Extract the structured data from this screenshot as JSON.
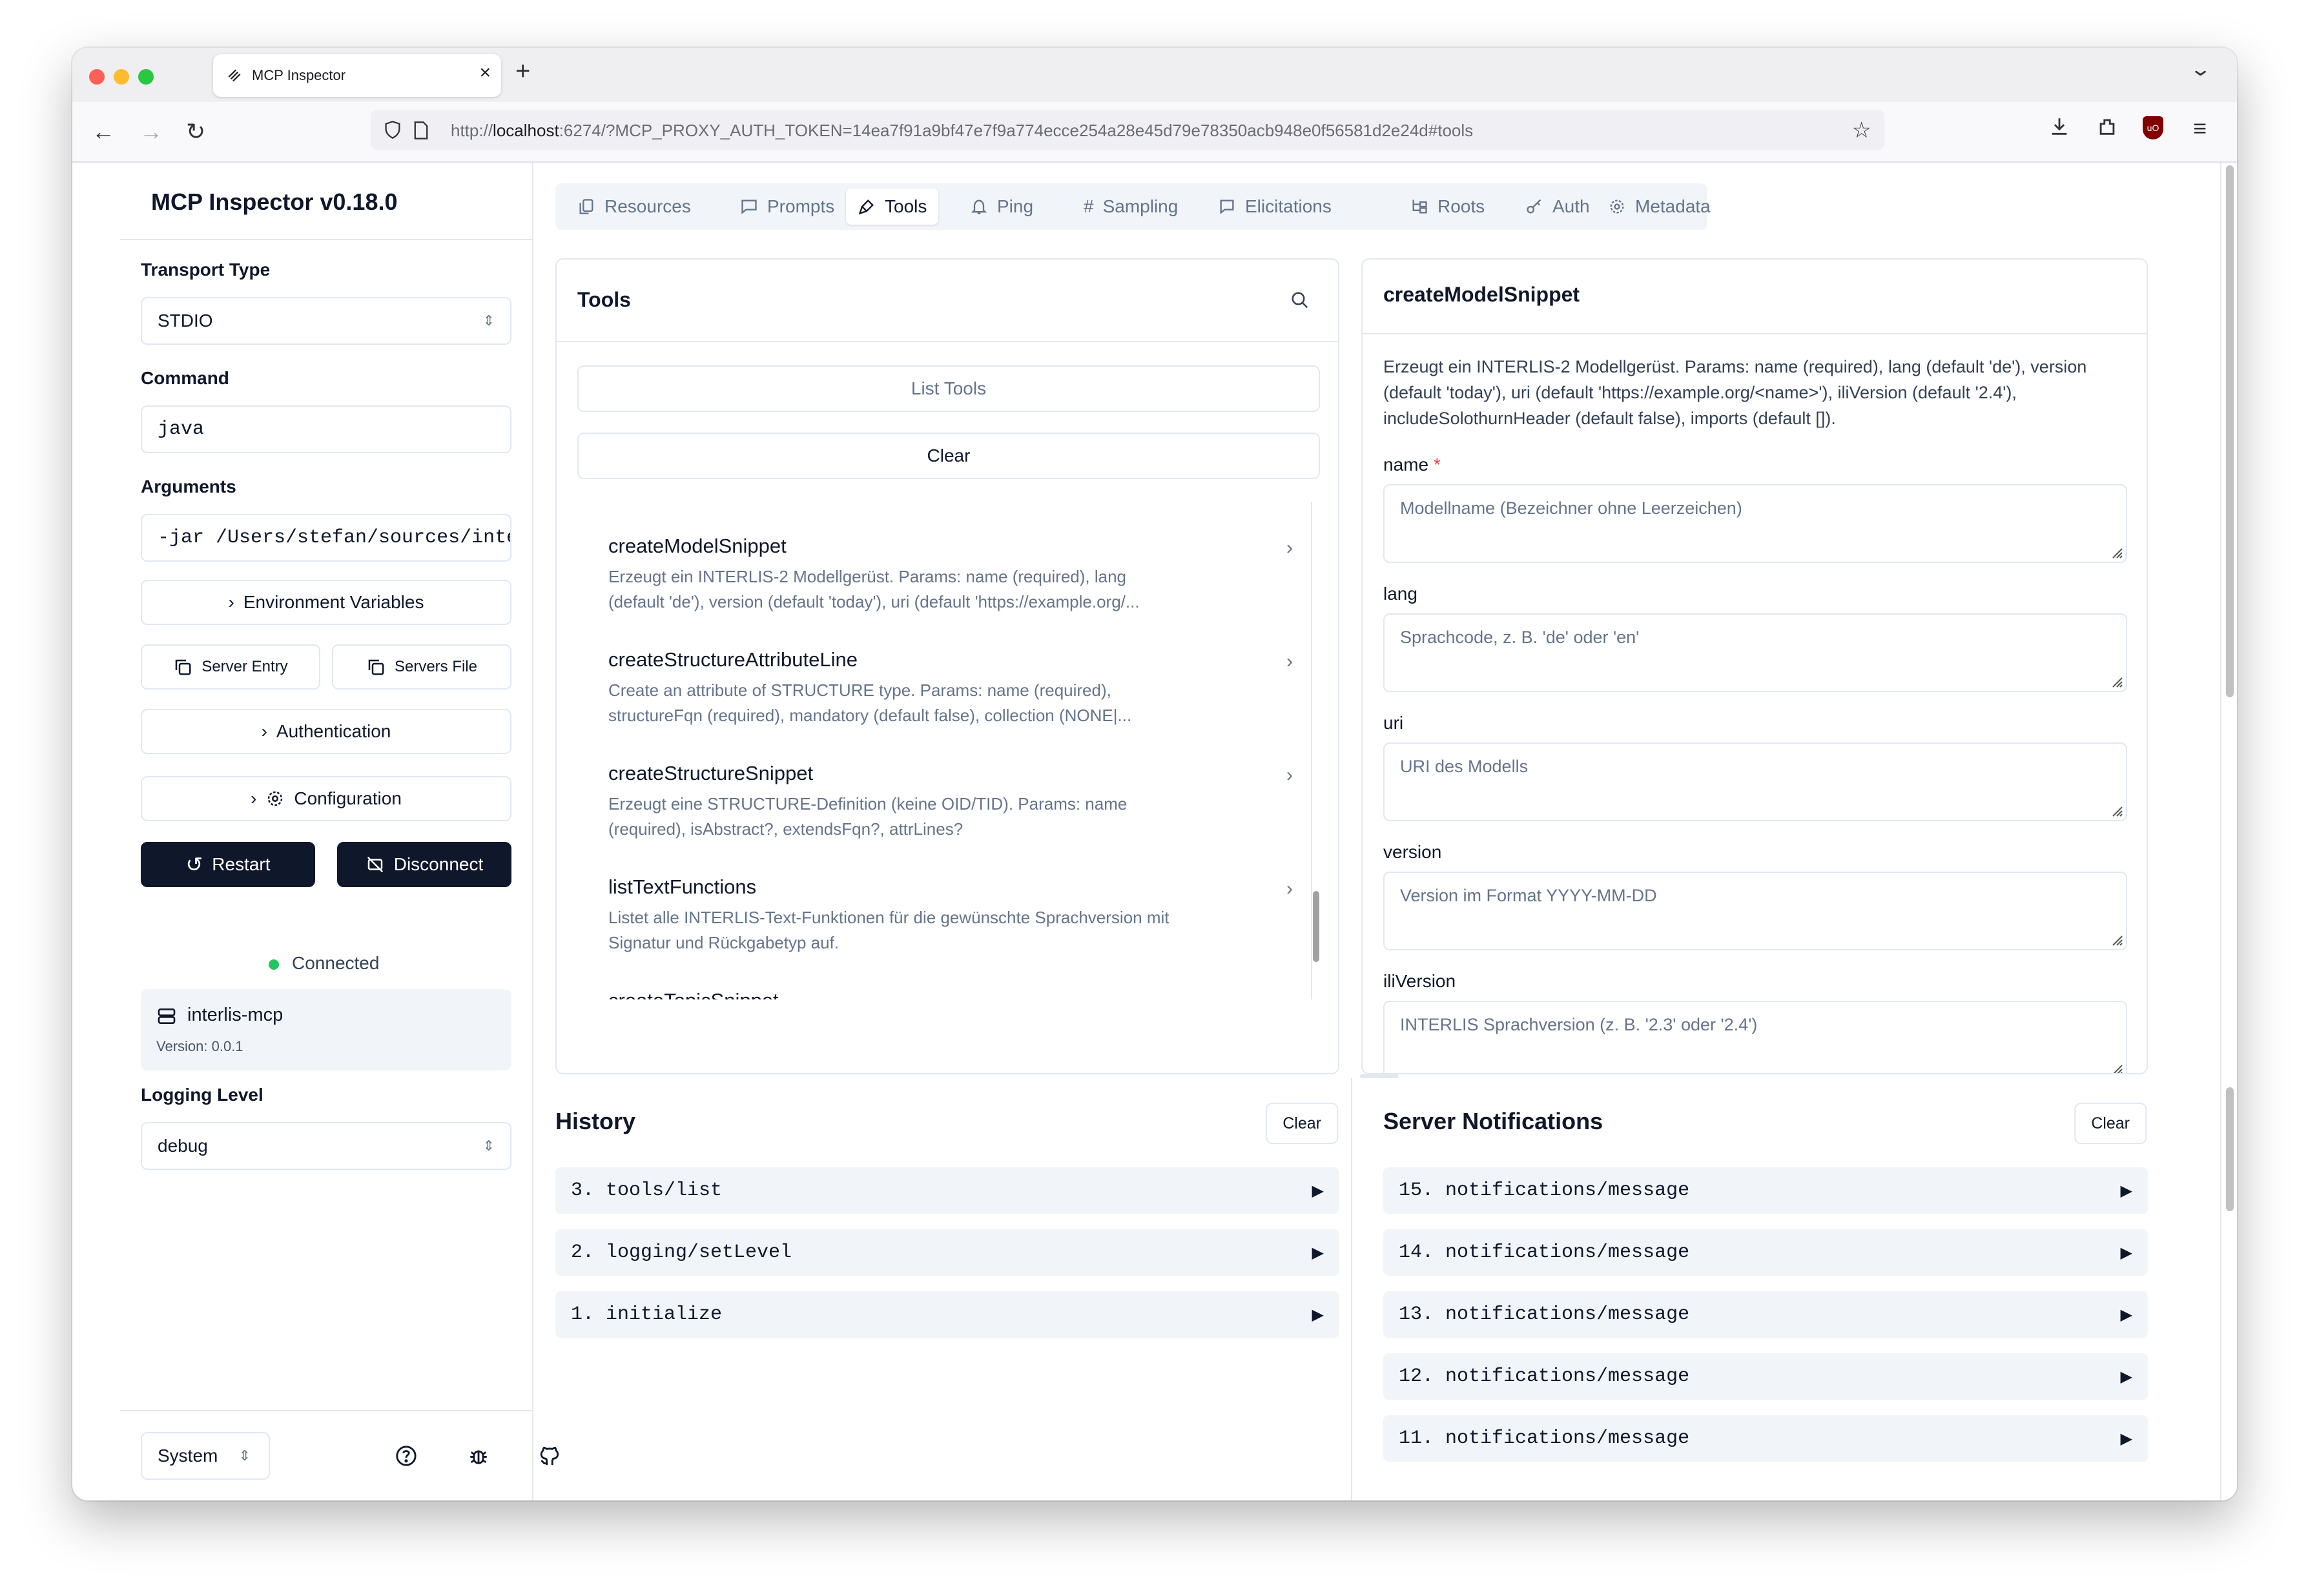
{
  "browser": {
    "tab_title": "MCP Inspector",
    "url_prefix": "http://",
    "url_host": "localhost",
    "url_rest": ":6274/?MCP_PROXY_AUTH_TOKEN=14ea7f91a9bf47e7f9a774ecce254a28e45d79e78350acb948e0f56581d2e24d#tools",
    "ublock_label": "uO"
  },
  "sidebar": {
    "title": "MCP Inspector v0.18.0",
    "transport_label": "Transport Type",
    "transport_value": "STDIO",
    "command_label": "Command",
    "command_value": "java",
    "arguments_label": "Arguments",
    "arguments_value": "-jar /Users/stefan/sources/inte",
    "env_button": "Environment Variables",
    "server_entry_button": "Server Entry",
    "servers_file_button": "Servers File",
    "auth_button": "Authentication",
    "config_button": "Configuration",
    "restart_button": "Restart",
    "disconnect_button": "Disconnect",
    "status": "Connected",
    "server_name": "interlis-mcp",
    "server_version": "Version: 0.0.1",
    "logging_label": "Logging Level",
    "logging_value": "debug",
    "theme_value": "System"
  },
  "tabs": [
    {
      "label": "Resources",
      "icon": "resources-icon"
    },
    {
      "label": "Prompts",
      "icon": "prompts-icon"
    },
    {
      "label": "Tools",
      "icon": "tools-icon"
    },
    {
      "label": "Ping",
      "icon": "bell-icon"
    },
    {
      "label": "Sampling",
      "icon": "hash-icon"
    },
    {
      "label": "Elicitations",
      "icon": "message-icon"
    },
    {
      "label": "Roots",
      "icon": "folder-tree-icon"
    },
    {
      "label": "Auth",
      "icon": "key-icon"
    },
    {
      "label": "Metadata",
      "icon": "gear-icon"
    }
  ],
  "active_tab": "Tools",
  "tools_panel": {
    "title": "Tools",
    "list_button": "List Tools",
    "clear_button": "Clear",
    "items": [
      {
        "name": "createModelSnippet",
        "desc1": "Erzeugt ein INTERLIS-2 Modellgerüst. Params: name (required), lang",
        "desc2": "(default 'de'), version (default 'today'), uri (default 'https://example.org/..."
      },
      {
        "name": "createStructureAttributeLine",
        "desc1": "Create an attribute of STRUCTURE type. Params: name (required),",
        "desc2": "structureFqn (required), mandatory (default false), collection (NONE|..."
      },
      {
        "name": "createStructureSnippet",
        "desc1": "Erzeugt eine STRUCTURE-Definition (keine OID/TID). Params: name",
        "desc2": "(required), isAbstract?, extendsFqn?, attrLines?"
      },
      {
        "name": "listTextFunctions",
        "desc1": "Listet alle INTERLIS-Text-Funktionen für die gewünschte Sprachversion mit",
        "desc2": "Signatur und Rückgabetyp auf."
      },
      {
        "name": "createTopicSnippet",
        "desc1": "",
        "desc2": ""
      }
    ]
  },
  "form_panel": {
    "title": "createModelSnippet",
    "description": "Erzeugt ein INTERLIS-2 Modellgerüst. Params: name (required), lang (default 'de'), version (default 'today'), uri (default 'https://example.org/<name>'), iliVersion (default '2.4'), includeSolothurnHeader (default false), imports (default []).",
    "required_mark": "*",
    "fields": [
      {
        "label": "name",
        "placeholder": "Modellname (Bezeichner ohne Leerzeichen)"
      },
      {
        "label": "lang",
        "placeholder": "Sprachcode, z. B. 'de' oder 'en'"
      },
      {
        "label": "uri",
        "placeholder": "URI des Modells"
      },
      {
        "label": "version",
        "placeholder": "Version im Format YYYY-MM-DD"
      },
      {
        "label": "iliVersion",
        "placeholder": "INTERLIS Sprachversion (z. B. '2.3' oder '2.4')"
      }
    ]
  },
  "history": {
    "title": "History",
    "clear_button": "Clear",
    "items": [
      "3. tools/list",
      "2. logging/setLevel",
      "1. initialize"
    ]
  },
  "notifications": {
    "title": "Server Notifications",
    "clear_button": "Clear",
    "items": [
      "15. notifications/message",
      "14. notifications/message",
      "13. notifications/message",
      "12. notifications/message",
      "11. notifications/message"
    ]
  }
}
